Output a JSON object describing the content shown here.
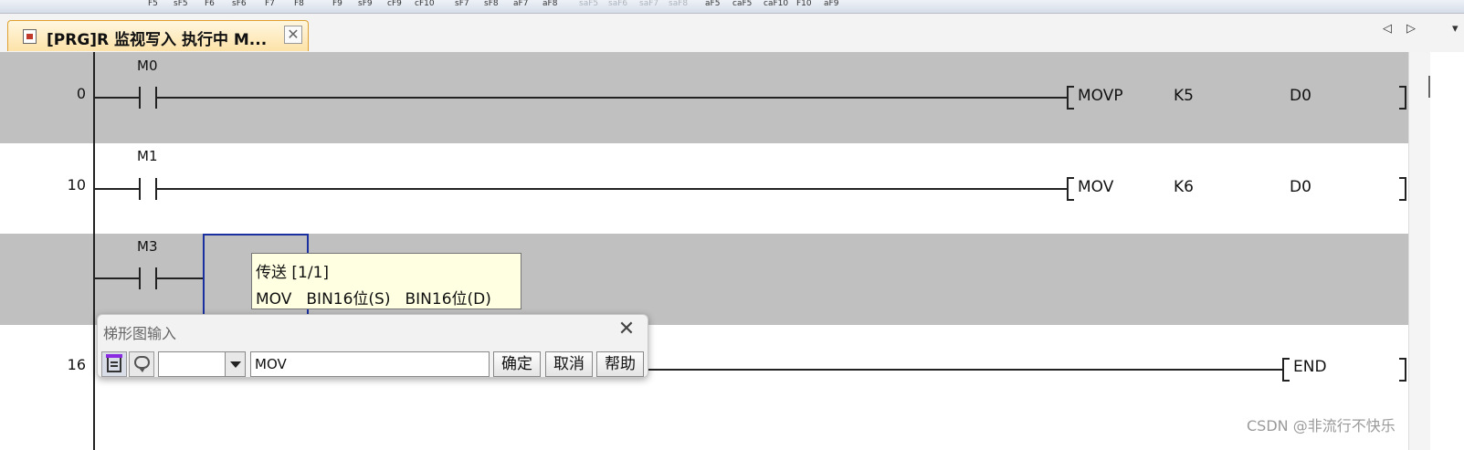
{
  "toolbar": {
    "function_keys": [
      "F5",
      "sF5",
      "F6",
      "sF6",
      "F7",
      "F8",
      "F9",
      "sF9",
      "cF9",
      "cF10",
      "sF7",
      "sF8",
      "aF7",
      "aF8",
      "saF5",
      "saF6",
      "saF7",
      "saF8",
      "aF5",
      "caF5",
      "caF10",
      "F10",
      "aF9"
    ]
  },
  "tab": {
    "title": "[PRG]R 监视写入 执行中 M...",
    "close_glyph": "✕"
  },
  "nav": {
    "left_glyph": "◁",
    "right_glyph": "▷",
    "menu_glyph": "▾"
  },
  "ladder": {
    "rungs": [
      {
        "step": "0",
        "contact": "M0",
        "instruction": "MOVP",
        "operand1": "K5",
        "operand2": "D0"
      },
      {
        "step": "10",
        "contact": "M1",
        "instruction": "MOV",
        "operand1": "K6",
        "operand2": "D0"
      },
      {
        "step": "",
        "contact": "M3"
      },
      {
        "step": "16",
        "instruction": "END"
      }
    ]
  },
  "tooltip": {
    "title": "传送 [1/1]",
    "args": [
      "MOV",
      "BIN16位(S)",
      "BIN16位(D)"
    ]
  },
  "dialog": {
    "title": "梯形图输入",
    "close_glyph": "✕",
    "select_value": "",
    "input_value": "MOV",
    "ok_label": "确定",
    "cancel_label": "取消",
    "help_label": "帮助"
  },
  "watermark": "CSDN @非流行不快乐"
}
